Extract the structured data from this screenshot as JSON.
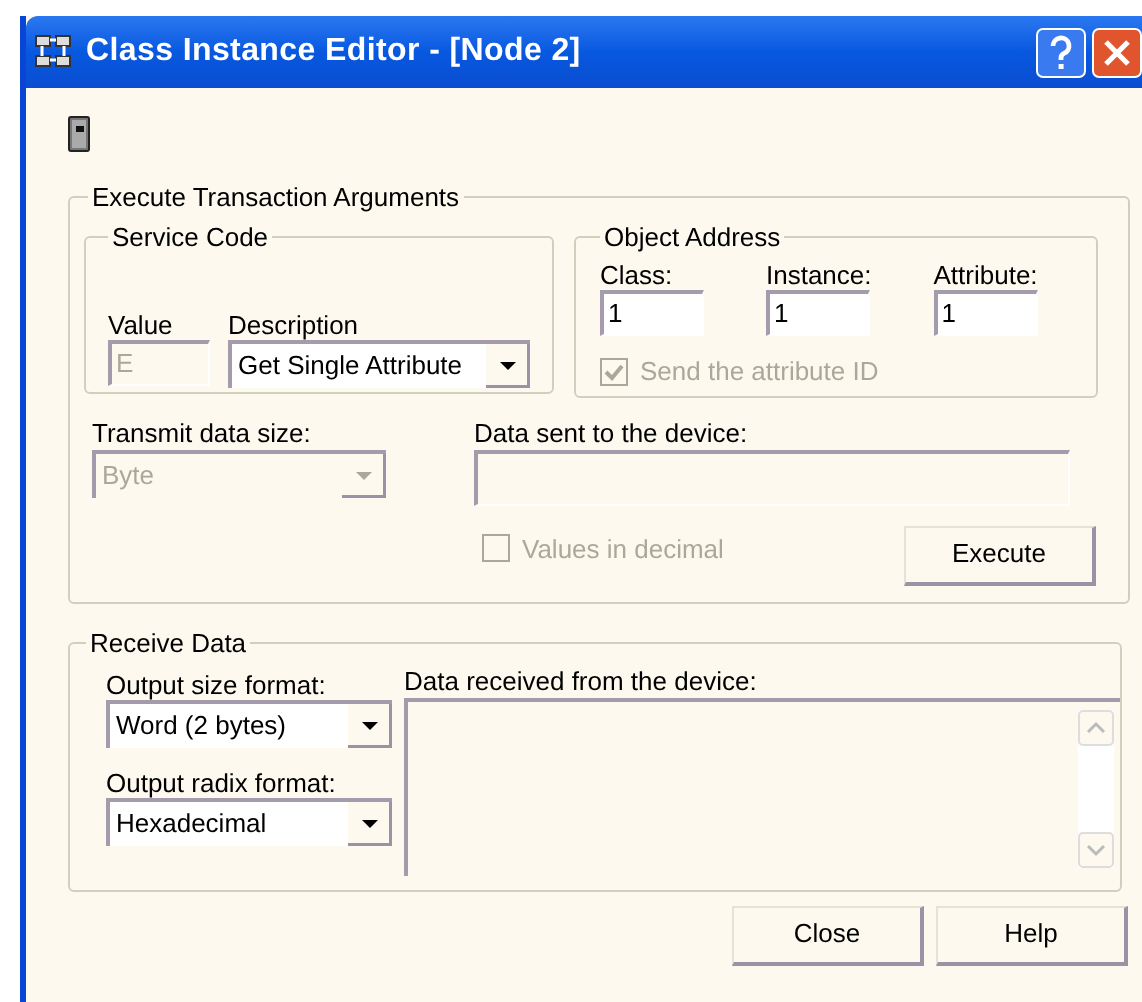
{
  "window": {
    "title": "Class Instance Editor - [Node 2]"
  },
  "execute_transaction_arguments": {
    "title": "Execute Transaction Arguments",
    "service_code": {
      "title": "Service Code",
      "value_field": {
        "label": "Value",
        "value": "E",
        "disabled": true
      },
      "description": {
        "label": "Description",
        "value": "Get Single Attribute",
        "disabled": false
      }
    },
    "object_address": {
      "title": "Object Address",
      "fields": [
        {
          "label": "Class:",
          "value": "1"
        },
        {
          "label": "Instance:",
          "value": "1"
        },
        {
          "label": "Attribute:",
          "value": "1"
        }
      ],
      "send_attribute_id": {
        "label": "Send the attribute ID",
        "checked": true,
        "disabled": true
      }
    },
    "transmit_data_size": {
      "label": "Transmit data size:",
      "value": "Byte",
      "disabled": true
    },
    "data_sent": {
      "label": "Data sent to the device:"
    },
    "values_in_decimal": {
      "label": "Values in decimal",
      "checked": false,
      "disabled": true
    },
    "execute_button": "Execute"
  },
  "receive_data": {
    "title": "Receive Data",
    "output_size_format": {
      "label": "Output size format:",
      "value": "Word (2 bytes)",
      "disabled": false
    },
    "output_radix_format": {
      "label": "Output radix format:",
      "value": "Hexadecimal",
      "disabled": false
    },
    "data_received": {
      "label": "Data received from the device:"
    }
  },
  "buttons": [
    "Close",
    "Help"
  ]
}
